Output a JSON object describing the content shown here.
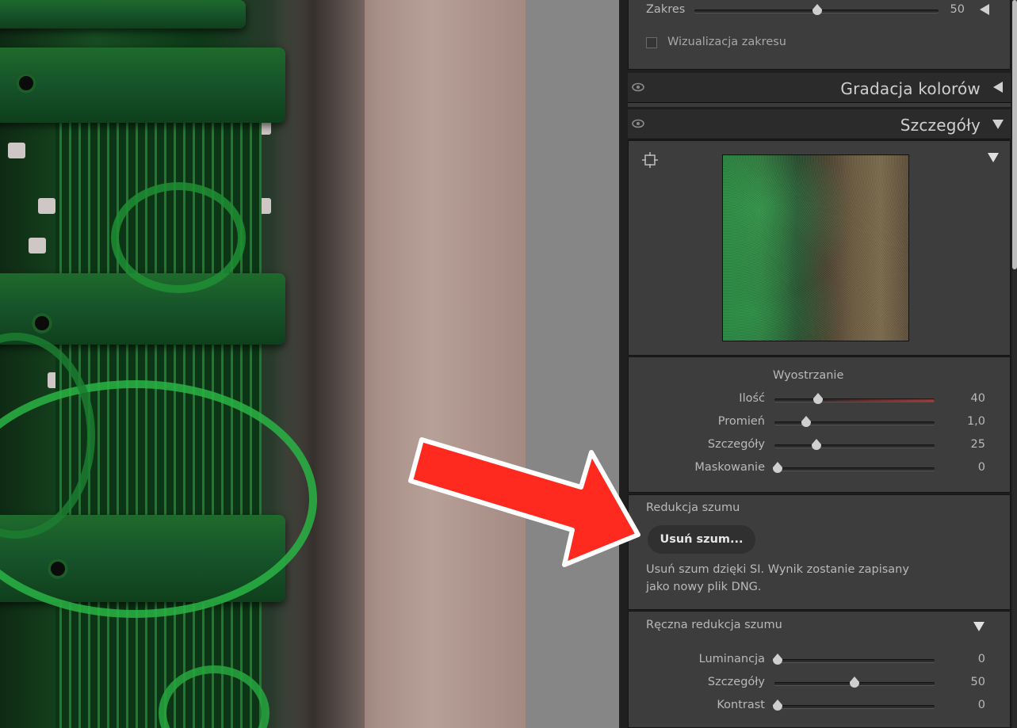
{
  "panel": {
    "zakres": {
      "label": "Zakres",
      "value": "50",
      "fraction": 0.5
    },
    "wizualizacja": {
      "label": "Wizualizacja zakresu"
    },
    "gradacja": {
      "title": "Gradacja kolorów"
    },
    "szczegoly": {
      "title": "Szczegóły"
    },
    "sharpen": {
      "heading": "Wyostrzanie",
      "sliders": [
        {
          "label": "Ilość",
          "value": "40",
          "fraction": 0.27
        },
        {
          "label": "Promień",
          "value": "1,0",
          "fraction": 0.2
        },
        {
          "label": "Szczegóły",
          "value": "25",
          "fraction": 0.26
        },
        {
          "label": "Maskowanie",
          "value": "0",
          "fraction": 0.02
        }
      ]
    },
    "noise": {
      "heading": "Redukcja szumu",
      "button": "Usuń szum...",
      "description_line1": "Usuń szum dzięki SI. Wynik zostanie zapisany",
      "description_line2": "jako nowy plik DNG."
    },
    "manual_noise": {
      "heading": "Ręczna redukcja szumu",
      "sliders": [
        {
          "label": "Luminancja",
          "value": "0",
          "fraction": 0.02
        },
        {
          "label": "Szczegóły",
          "value": "50",
          "fraction": 0.5
        },
        {
          "label": "Kontrast",
          "value": "0",
          "fraction": 0.02
        }
      ]
    }
  },
  "icons": [
    "eye-icon",
    "target-crosshair-icon",
    "triangle-left-icon",
    "triangle-down-icon"
  ],
  "colors": {
    "annotation_arrow": "#ff2a1f",
    "panel_bg": "#3d3d3d",
    "header_bg": "#2b2b2b"
  }
}
